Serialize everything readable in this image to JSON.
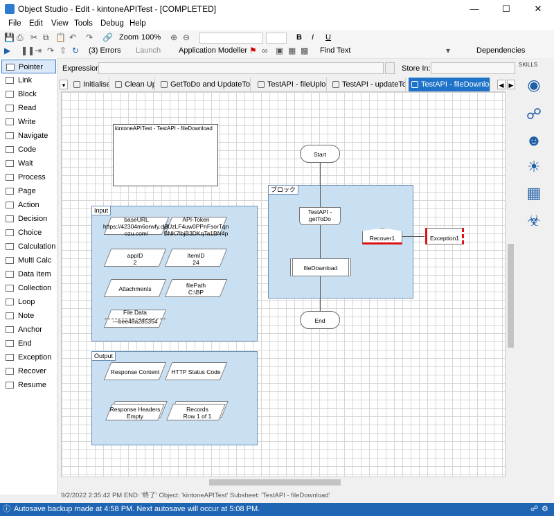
{
  "window": {
    "title": "Object Studio  - Edit - kintoneAPITest - [COMPLETED]"
  },
  "menu": [
    "File",
    "Edit",
    "View",
    "Tools",
    "Debug",
    "Help"
  ],
  "toolbar1": {
    "zoom_label": "Zoom",
    "zoom_value": "100%"
  },
  "toolbar2": {
    "errors": "(3) Errors",
    "launch": "Launch",
    "app_modeller": "Application Modeller",
    "find_text": "Find Text",
    "dependencies": "Dependencies"
  },
  "expression": {
    "label": "Expression:",
    "store_label": "Store In:"
  },
  "toolbox": [
    "Pointer",
    "Link",
    "Block",
    "Read",
    "Write",
    "Navigate",
    "Code",
    "Wait",
    "Process",
    "Page",
    "Action",
    "Decision",
    "Choice",
    "Calculation",
    "Multi Calc",
    "Data Item",
    "Collection",
    "Loop",
    "Note",
    "Anchor",
    "End",
    "Exception",
    "Recover",
    "Resume"
  ],
  "tabs": [
    "Initialise",
    "Clean Up",
    "GetToDo and UpdateToDo",
    "TestAPI - fileUpload",
    "TestAPI - updateTodo",
    "TestAPI - fileDownload"
  ],
  "skills_label": "SKILLS",
  "diagram": {
    "info_box_title": "kintoneAPITest - TestAPI - fileDownload",
    "input_label": "Input",
    "output_label": "Output",
    "block_label": "ブロック",
    "inputs": [
      {
        "name": "baseURL",
        "value": "https://42304m6orwfy.cybozu.com/"
      },
      {
        "name": "API-Token",
        "value": "l3UzLF4uw0PPnFsorTqnBNK7lbjB3DKqTa1BN4p"
      },
      {
        "name": "appID",
        "value": "2"
      },
      {
        "name": "ItemID",
        "value": "24"
      },
      {
        "name": "Attachments",
        "value": ""
      },
      {
        "name": "filePath",
        "value": "C:\\BP"
      },
      {
        "name": "File Data",
        "value": "---bee48a285354"
      }
    ],
    "outputs": [
      {
        "name": "Response Content",
        "value": ""
      },
      {
        "name": "HTTP Status Code",
        "value": ""
      },
      {
        "name": "Response Headers",
        "value": "Empty"
      },
      {
        "name": "Records",
        "value": "Row 1 of 1"
      }
    ],
    "start": "Start",
    "stage1": "TestAPI - getToDo",
    "stage2": "fileDownload",
    "recover": "Recover1",
    "exception": "Exception1",
    "end": "End"
  },
  "status": {
    "log": "9/2/2022 2:35:42 PM END: '終了' Object: 'kintoneAPITest' Subsheet: 'TestAPI - fileDownload'",
    "autosave": "Autosave backup made at 4:58 PM. Next autosave will occur at 5:08 PM."
  }
}
